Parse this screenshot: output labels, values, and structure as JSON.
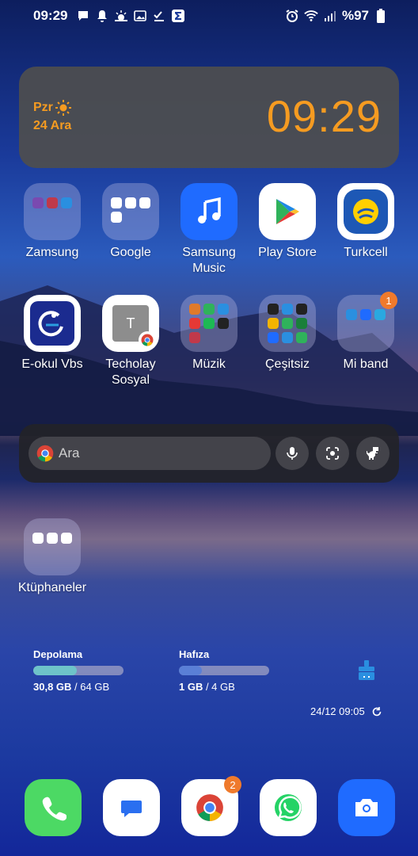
{
  "status_bar": {
    "time": "09:29",
    "battery": "%97",
    "left_icons": [
      "message-icon",
      "bell-icon",
      "weather-icon",
      "gallery-icon",
      "checklist-icon",
      "sigma-icon"
    ],
    "right_icons": [
      "alarm-icon",
      "wifi-icon",
      "signal-icon",
      "battery-icon"
    ]
  },
  "clock_widget": {
    "day": "Pzr",
    "date": "24 Ara",
    "time": "09:29",
    "accent_color": "#f59b21"
  },
  "apps_row1": [
    {
      "label": "Zamsung",
      "type": "folder"
    },
    {
      "label": "Google",
      "type": "folder"
    },
    {
      "label": "Samsung Music",
      "type": "app"
    },
    {
      "label": "Play Store",
      "type": "app"
    },
    {
      "label": "Turkcell",
      "type": "app"
    }
  ],
  "apps_row2": [
    {
      "label": "E-okul Vbs",
      "type": "app"
    },
    {
      "label": "Techolay Sosyal",
      "type": "app"
    },
    {
      "label": "Müzik",
      "type": "folder"
    },
    {
      "label": "Çeşitsiz",
      "type": "folder"
    },
    {
      "label": "Mi band",
      "type": "folder",
      "badge": "1"
    }
  ],
  "tile_letter": "T",
  "search": {
    "placeholder": "Ara",
    "icons": [
      "mic-icon",
      "lens-icon",
      "dino-icon"
    ]
  },
  "library_folder": {
    "label": "Ktüphaneler"
  },
  "storage_widget": {
    "storage_label": "Depolama",
    "storage_used": "30,8 GB",
    "storage_total": " / 64 GB",
    "storage_fraction": 0.48,
    "memory_label": "Hafıza",
    "memory_used": "1 GB",
    "memory_total": " / 4 GB",
    "memory_fraction": 0.25,
    "updated": "24/12 09:05"
  },
  "dock": [
    {
      "name": "phone",
      "badge": ""
    },
    {
      "name": "messages",
      "badge": ""
    },
    {
      "name": "chrome",
      "badge": "2"
    },
    {
      "name": "whatsapp",
      "badge": ""
    },
    {
      "name": "camera",
      "badge": ""
    }
  ]
}
